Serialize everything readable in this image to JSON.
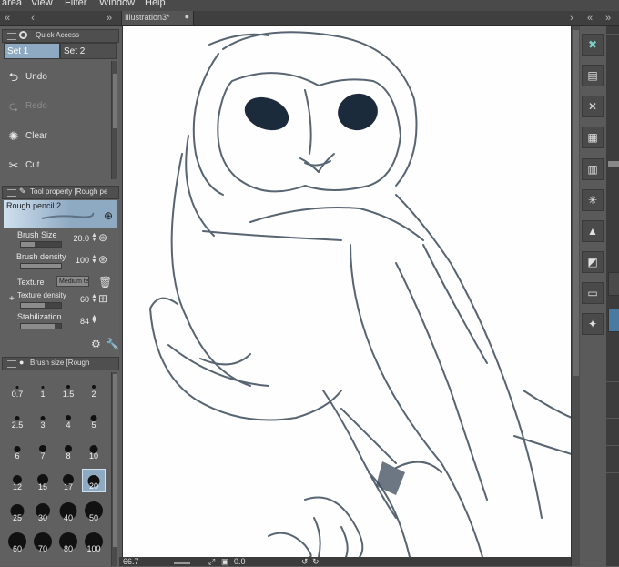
{
  "menu": [
    "area",
    "View",
    "Filter",
    "Window",
    "Help"
  ],
  "document_tab": {
    "title": "Illustration3*",
    "close": "●"
  },
  "quick_access": {
    "header": "Quick Access",
    "sets": [
      "Set 1",
      "Set 2"
    ],
    "items": [
      {
        "label": "Undo",
        "icon": "undo-icon",
        "glyph": "⮌"
      },
      {
        "label": "Redo",
        "icon": "redo-icon",
        "glyph": "⮎"
      },
      {
        "label": "Clear",
        "icon": "clear-icon",
        "glyph": "✺"
      },
      {
        "label": "Cut",
        "icon": "scissors-icon",
        "glyph": "✂"
      }
    ]
  },
  "tool_property": {
    "header": "Tool property [Rough pe",
    "tool_name": "Rough pencil 2",
    "brush_size_label": "Brush Size",
    "brush_size_value": "20.0",
    "brush_size_fill": 0.35,
    "brush_density_label": "Brush density",
    "brush_density_value": "100",
    "brush_density_fill": 1.0,
    "texture_label": "Texture",
    "texture_value": "Medium tex",
    "texture_density_label": "Texture density",
    "texture_density_value": "60",
    "texture_density_fill": 0.6,
    "stabilization_label": "Stabilization",
    "stabilization_value": "84",
    "stabilization_fill": 0.84
  },
  "brush_size_panel": {
    "header": "Brush size [Rough",
    "sizes": [
      "0.7",
      "1",
      "1.5",
      "2",
      "2.5",
      "3",
      "4",
      "5",
      "6",
      "7",
      "8",
      "10",
      "12",
      "15",
      "17",
      "20",
      "25",
      "30",
      "40",
      "50",
      "60",
      "70",
      "80",
      "100"
    ],
    "selected": "20"
  },
  "status": {
    "zoom": "66.7",
    "angle": "0.0"
  },
  "colors": {
    "accent_selected": "#8ea9c2",
    "panel_bg": "#606060",
    "canvas": "#fefefe",
    "sketch_stroke": "#3b4a5a"
  }
}
